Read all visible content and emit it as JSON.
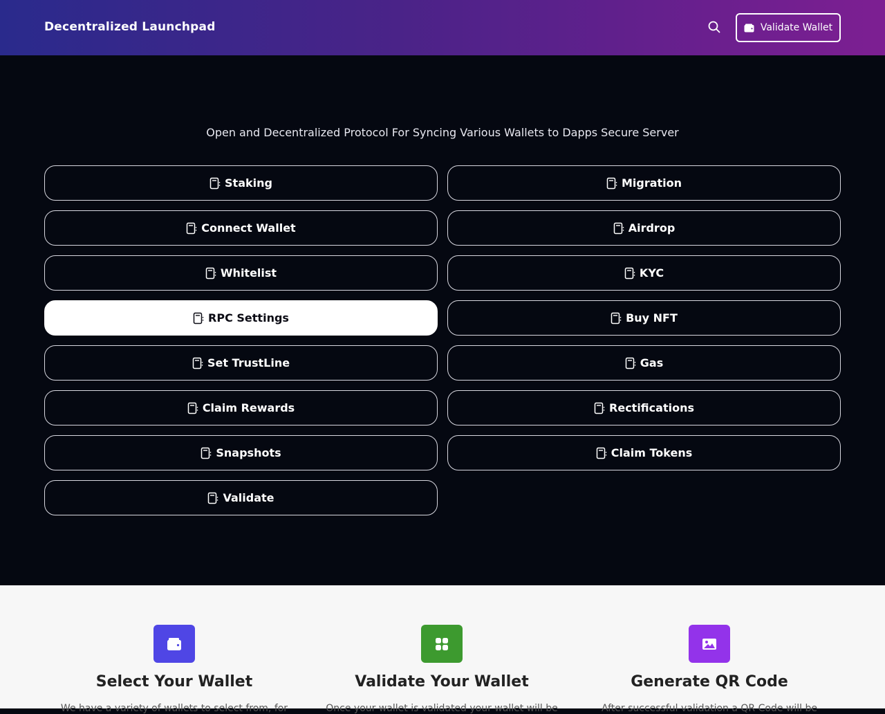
{
  "header": {
    "brand": "Decentralized Launchpad",
    "search_icon": "search-icon",
    "validate_wallet_label": "Validate Wallet",
    "validate_wallet_icon": "wallet-icon"
  },
  "hero": {
    "subtitle": "Open and Decentralized Protocol For Syncing Various Wallets to Dapps Secure Server",
    "button_icon": "clipboard-icon",
    "buttons": [
      {
        "label": "Staking"
      },
      {
        "label": "Migration"
      },
      {
        "label": "Connect Wallet"
      },
      {
        "label": "Airdrop"
      },
      {
        "label": "Whitelist"
      },
      {
        "label": "KYC"
      },
      {
        "label": "RPC Settings",
        "active": true
      },
      {
        "label": "Buy NFT"
      },
      {
        "label": "Set TrustLine"
      },
      {
        "label": "Gas"
      },
      {
        "label": "Claim Rewards"
      },
      {
        "label": "Rectifications"
      },
      {
        "label": "Snapshots"
      },
      {
        "label": "Claim Tokens"
      },
      {
        "label": "Validate"
      }
    ]
  },
  "features": [
    {
      "title": "Select Your Wallet",
      "icon": "wallet-icon",
      "color": "#4f46e5",
      "desc": "We have a variety of wallets to select from, for"
    },
    {
      "title": "Validate Your Wallet",
      "icon": "grid-icon",
      "color": "#3d9a2f",
      "desc": "Once your wallet is validated your wallet will be"
    },
    {
      "title": "Generate QR Code",
      "icon": "image-icon",
      "color": "#9333ea",
      "desc": "After successful validation a QR Code will be"
    }
  ],
  "colors": {
    "header_gradient_start": "#2a2a8c",
    "header_gradient_end": "#7d1f92",
    "hero_bg": "#050811",
    "features_bg": "#f7f7f7"
  }
}
